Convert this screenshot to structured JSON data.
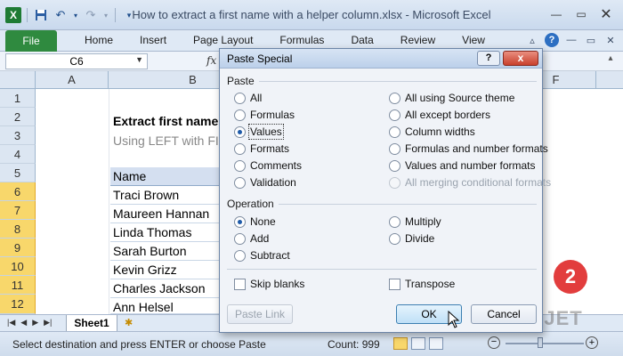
{
  "window": {
    "title": "How to extract a first name with a helper column.xlsx - Microsoft Excel",
    "app_icon": "X"
  },
  "ribbon": {
    "file_tab": "File",
    "tabs": [
      "Home",
      "Insert",
      "Page Layout",
      "Formulas",
      "Data",
      "Review",
      "View"
    ]
  },
  "formula_bar": {
    "name_box": "C6",
    "fx": "fx"
  },
  "grid": {
    "columns": [
      "A",
      "B",
      "F"
    ],
    "rows": [
      "1",
      "2",
      "3",
      "4",
      "5",
      "6",
      "7",
      "8",
      "9",
      "10",
      "11",
      "12"
    ],
    "selected_rows": [
      "6",
      "7",
      "8",
      "9",
      "10",
      "11",
      "12"
    ],
    "title": "Extract first name",
    "subtitle": "Using LEFT with FI",
    "table_header": "Name",
    "names": [
      "Traci Brown",
      "Maureen Hannan",
      "Linda Thomas",
      "Sarah Burton",
      "Kevin Grizz",
      "Charles Jackson",
      "Ann Helsel"
    ]
  },
  "sheets": {
    "active": "Sheet1"
  },
  "status": {
    "message": "Select destination and press ENTER or choose Paste",
    "count": "Count: 999"
  },
  "dialog": {
    "title": "Paste Special",
    "help": "?",
    "close": "x",
    "paste_label": "Paste",
    "paste_left": [
      {
        "label": "All",
        "checked": false
      },
      {
        "label": "Formulas",
        "checked": false
      },
      {
        "label": "Values",
        "checked": true
      },
      {
        "label": "Formats",
        "checked": false
      },
      {
        "label": "Comments",
        "checked": false
      },
      {
        "label": "Validation",
        "checked": false
      }
    ],
    "paste_right": [
      {
        "label": "All using Source theme",
        "checked": false,
        "disabled": false
      },
      {
        "label": "All except borders",
        "checked": false,
        "disabled": false
      },
      {
        "label": "Column widths",
        "checked": false,
        "disabled": false
      },
      {
        "label": "Formulas and number formats",
        "checked": false,
        "disabled": false
      },
      {
        "label": "Values and number formats",
        "checked": false,
        "disabled": false
      },
      {
        "label": "All merging conditional formats",
        "checked": false,
        "disabled": true
      }
    ],
    "operation_label": "Operation",
    "op_left": [
      {
        "label": "None",
        "checked": true
      },
      {
        "label": "Add",
        "checked": false
      },
      {
        "label": "Subtract",
        "checked": false
      }
    ],
    "op_right": [
      {
        "label": "Multiply",
        "checked": false
      },
      {
        "label": "Divide",
        "checked": false
      }
    ],
    "skip_blanks": "Skip blanks",
    "transpose": "Transpose",
    "paste_link": "Paste Link",
    "ok": "OK",
    "cancel": "Cancel"
  },
  "badge": "2",
  "watermark": "EXCELJET",
  "colors": {
    "file_tab": "#2f8a3f",
    "selected_row": "#f8d76b",
    "badge": "#e23d3d"
  }
}
